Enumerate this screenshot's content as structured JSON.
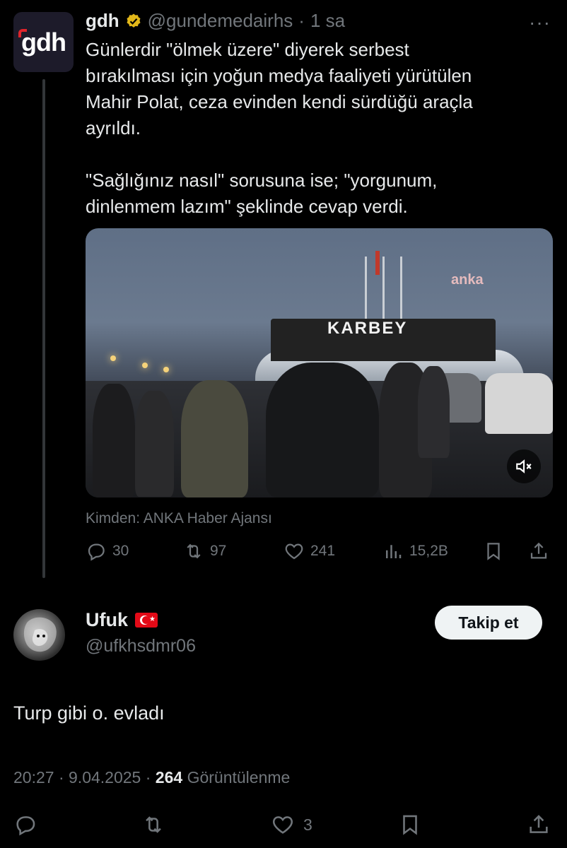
{
  "quoted": {
    "avatar_text": "gdh",
    "name": "gdh",
    "handle": "@gundemedairhs",
    "separator": "·",
    "time": "1 sa",
    "more": "···",
    "text": "Günlerdir \"ölmek üzere\" diyerek serbest\nbırakılması için yoğun medya faaliyeti yürütülen\nMahir Polat, ceza evinden kendi sürdüğü araçla\nayrıldı.\n\n\"Sağlığınız nasıl\" sorusuna ise; \"yorgunum,\ndinlenmem lazım\" şeklinde cevap verdi.",
    "media": {
      "sign": "KARBEY",
      "watermark": "anka"
    },
    "source": "Kimden: ANKA Haber Ajansı",
    "stats": {
      "replies": "30",
      "retweets": "97",
      "likes": "241",
      "views": "15,2B"
    }
  },
  "reply": {
    "name": "Ufuk",
    "handle": "@ufkhsdmr06",
    "follow_label": "Takip et",
    "text": "Turp gibi o. evladı",
    "time": "20:27",
    "date": "9.04.2025",
    "sep": "·",
    "views_count": "264",
    "views_label": "Görüntülenme",
    "likes": "3"
  },
  "colors": {
    "background": "#000000",
    "text": "#e7e9ea",
    "muted": "#71767b",
    "verified": "#e2b719"
  }
}
